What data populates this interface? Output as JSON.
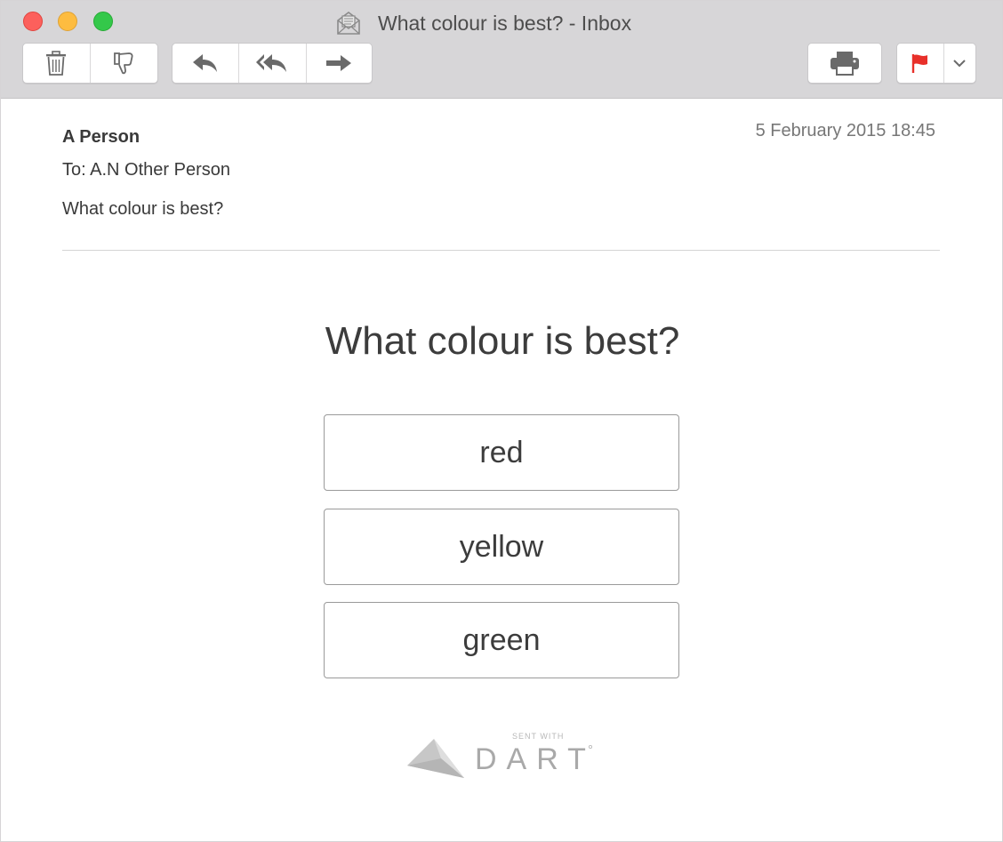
{
  "window": {
    "title": "What colour is best? - Inbox",
    "traffic_lights": {
      "close": "#fc605c",
      "minimize": "#fdbc40",
      "maximize": "#34c84a"
    }
  },
  "toolbar": {
    "icons": [
      "trash-icon",
      "thumbs-down-icon",
      "reply-icon",
      "reply-all-icon",
      "forward-icon",
      "print-icon",
      "flag-icon",
      "chevron-down-icon"
    ],
    "flag_color": "#e8302a"
  },
  "message": {
    "from": "A Person",
    "to": "To: A.N Other Person",
    "subject": "What colour is best?",
    "date": "5 February 2015 18:45"
  },
  "poll": {
    "question": "What colour is best?",
    "options": [
      "red",
      "yellow",
      "green"
    ]
  },
  "footer": {
    "sent_with": "SENT WITH",
    "brand": "DART"
  }
}
